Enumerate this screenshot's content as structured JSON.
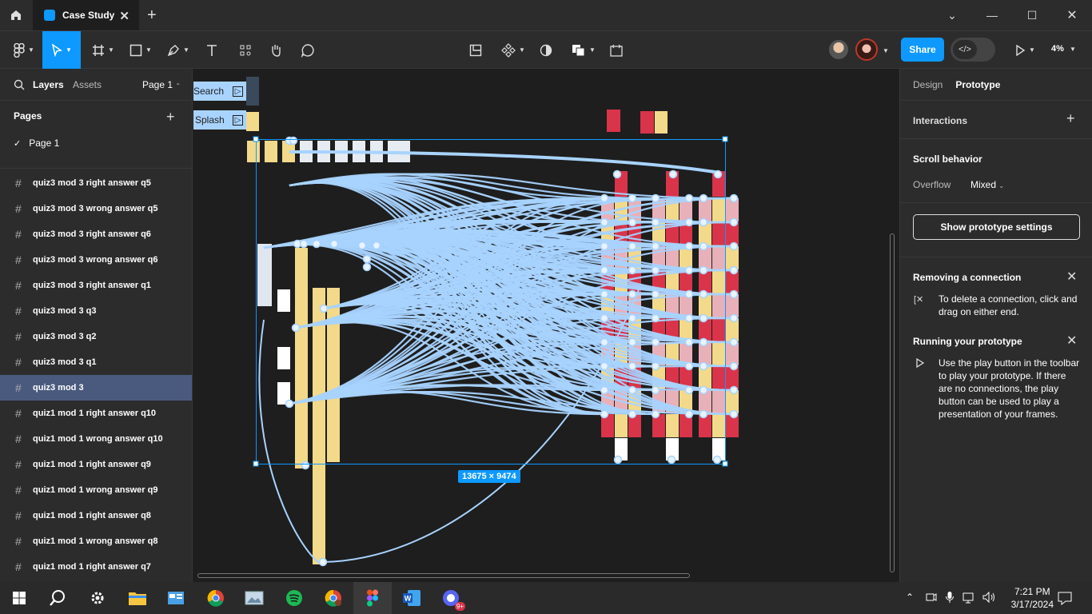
{
  "tabs": {
    "document_title": "Case Study"
  },
  "toolbar": {
    "share_label": "Share",
    "zoom_level": "4%"
  },
  "left_panel": {
    "layers_tab": "Layers",
    "assets_tab": "Assets",
    "page_selector": "Page 1",
    "pages_heading": "Pages",
    "current_page": "Page 1",
    "layers": [
      "quiz3 mod 3 right answer q5",
      "quiz3 mod 3 wrong answer q5",
      "quiz3 mod 3 right answer q6",
      "quiz3 mod 3 wrong answer q6",
      "quiz3 mod 3 right answer q1",
      "quiz3 mod 3 q3",
      "quiz3 mod 3 q2",
      "quiz3 mod 3 q1",
      "quiz3 mod 3",
      "quiz1 mod 1 right answer q10",
      "quiz1 mod 1 wrong answer q10",
      "quiz1 mod 1 right answer q9",
      "quiz1 mod 1 wrong answer q9",
      "quiz1 mod 1 right answer q8",
      "quiz1 mod 1 wrong answer q8",
      "quiz1 mod 1 right answer q7"
    ],
    "selected_layer": "quiz3 mod 3"
  },
  "canvas": {
    "flow_labels": [
      "Search",
      "Splash"
    ],
    "selection_size": "13675 × 9474"
  },
  "right_panel": {
    "design_tab": "Design",
    "prototype_tab": "Prototype",
    "interactions_heading": "Interactions",
    "scroll_heading": "Scroll behavior",
    "overflow_label": "Overflow",
    "overflow_value": "Mixed",
    "settings_button": "Show prototype settings",
    "tip1_title": "Removing a connection",
    "tip1_text": "To delete a connection, click and drag on either end.",
    "tip2_title": "Running your prototype",
    "tip2_text": "Use the play button in the toolbar to play your prototype. If there are no connections, the play button can be used to play a presentation of your frames."
  },
  "help_label": "?",
  "taskbar": {
    "time": "7:21 PM",
    "date": "3/17/2024",
    "badge": "9+"
  },
  "colors": {
    "accent": "#0d99ff",
    "connection": "#a8d3ff",
    "selected_layer": "#4a5a7e",
    "frame_red": "#d9344a",
    "frame_yellow": "#f3d98a"
  }
}
